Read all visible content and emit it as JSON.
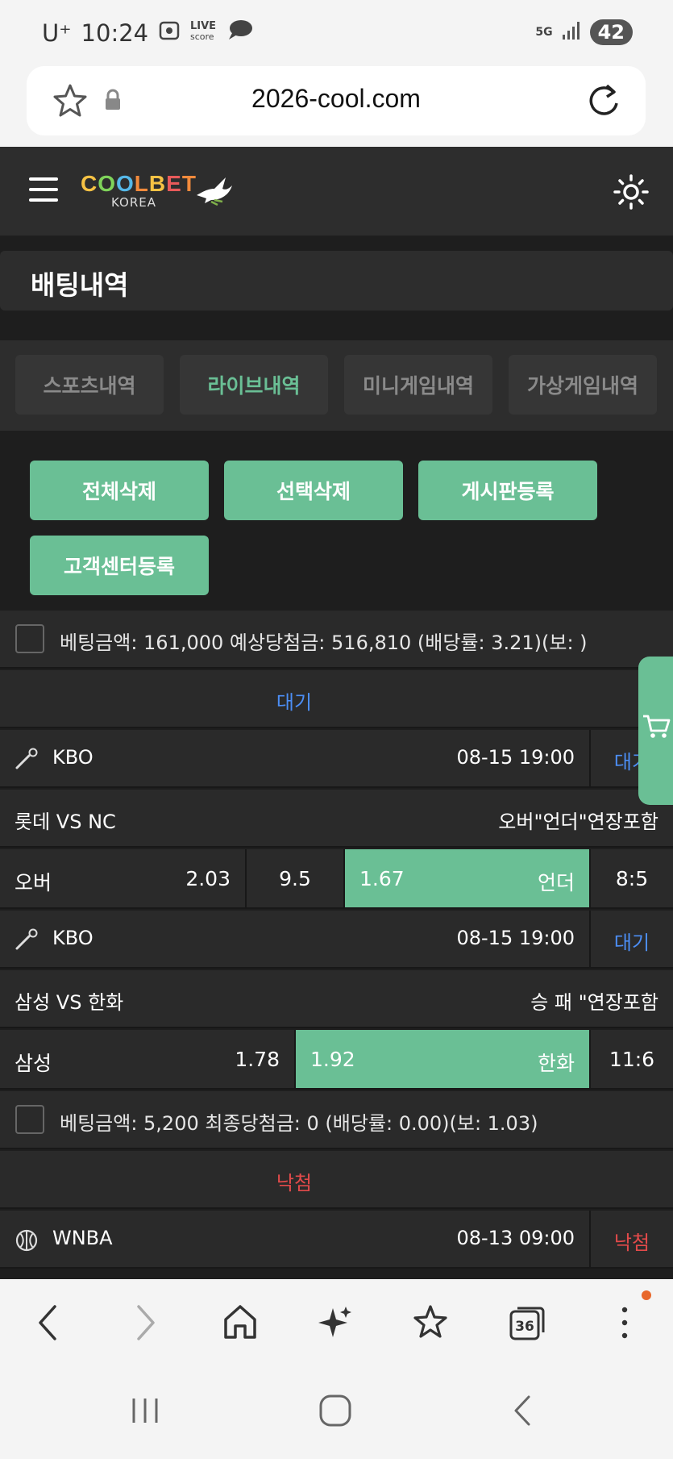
{
  "status_bar": {
    "carrier": "U⁺",
    "time": "10:24",
    "network": "5G",
    "battery": "42"
  },
  "browser": {
    "url": "2026-cool.com",
    "tab_count": "36"
  },
  "header": {
    "logo_text": "COOLBET",
    "logo_sub": "KOREA"
  },
  "page": {
    "title": "배팅내역"
  },
  "tabs": [
    {
      "label": "스포츠내역"
    },
    {
      "label": "라이브내역"
    },
    {
      "label": "미니게임내역"
    },
    {
      "label": "가상게임내역"
    }
  ],
  "actions": {
    "delete_all": "전체삭제",
    "delete_selected": "선택삭제",
    "board_register": "게시판등록",
    "support_register": "고객센터등록"
  },
  "bets": [
    {
      "info": "베팅금액:   161,000   예상당첨금: 516,810 (배당률: 3.21)(보: )",
      "status": "대기",
      "picks": [
        {
          "league": "KBO",
          "datetime": "08-15 19:00",
          "status": "대기",
          "teams": "롯데   VS   NC",
          "market": "오버\"언더\"연장포함",
          "home_label": "오버",
          "home_odds": "2.03",
          "line": "9.5",
          "away_odds": "1.67",
          "away_label": "언더",
          "score": "8:5"
        },
        {
          "league": "KBO",
          "datetime": "08-15 19:00",
          "status": "대기",
          "teams": "삼성   VS   한화",
          "market": "승 패 \"연장포함",
          "home_label": "삼성",
          "home_odds": "1.78",
          "away_odds": "1.92",
          "away_label": "한화",
          "score": "11:6"
        }
      ]
    },
    {
      "info": "베팅금액:   5,200   최종당첨금: 0 (배당률: 0.00)(보: 1.03)",
      "status": "낙첨",
      "picks": [
        {
          "league": "WNBA",
          "datetime": "08-13 09:00",
          "status": "낙첨"
        }
      ]
    }
  ],
  "colors": {
    "accent": "#6abf95",
    "pending": "#4c8ef5",
    "lost": "#e24a4a",
    "bg": "#1e1e1e"
  }
}
